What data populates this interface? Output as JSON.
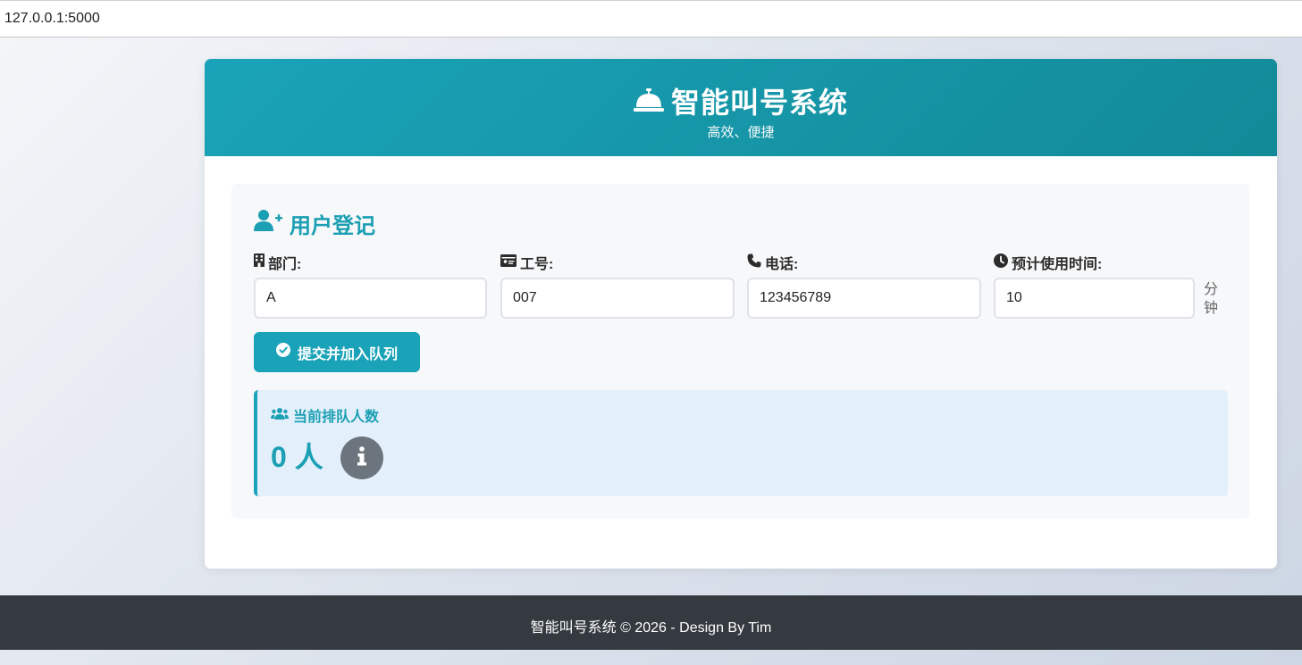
{
  "browser": {
    "url": "127.0.0.1:5000"
  },
  "header": {
    "icon": "concierge-bell-icon",
    "title": "智能叫号系统",
    "subtitle": "高效、便捷"
  },
  "registration": {
    "title": "用户登记",
    "icon": "user-plus-icon",
    "fields": [
      {
        "label": "部门:",
        "icon": "building-icon",
        "value": "A"
      },
      {
        "label": "工号:",
        "icon": "id-card-icon",
        "value": "007"
      },
      {
        "label": "电话:",
        "icon": "phone-icon",
        "value": "123456789"
      },
      {
        "label": "预计使用时间:",
        "icon": "clock-icon",
        "value": "10",
        "unit": "分钟"
      }
    ],
    "submit_label": "提交并加入队列"
  },
  "queue": {
    "label": "当前排队人数",
    "icon": "users-icon",
    "count": "0 人"
  },
  "footer": {
    "text": "智能叫号系统 © 2026 - Design By Tim"
  },
  "colors": {
    "primary": "#1aa3b8",
    "footer_bg": "#343a40",
    "queue_bg": "#e3f0fb",
    "info_btn": "#6c757d"
  }
}
